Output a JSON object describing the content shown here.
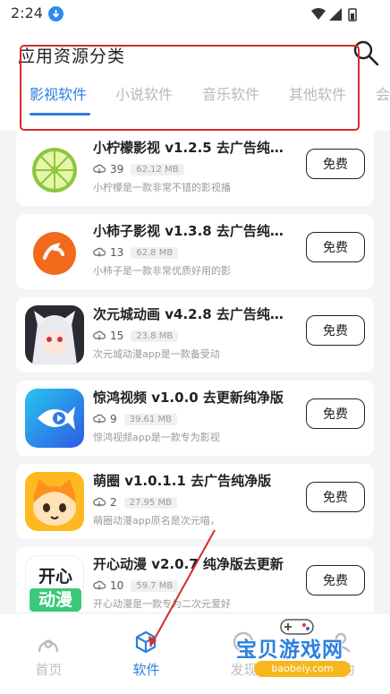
{
  "status_bar": {
    "time": "2:24"
  },
  "header": {
    "title": "应用资源分类",
    "tabs": [
      {
        "label": "影视软件"
      },
      {
        "label": "小说软件"
      },
      {
        "label": "音乐软件"
      },
      {
        "label": "其他软件"
      },
      {
        "label": "会"
      }
    ],
    "active_tab": 0
  },
  "apps": [
    {
      "name": "小柠檬影视 v1.2.5 去广告纯…",
      "downloads": "39",
      "size": "62.12 MB",
      "desc": "小柠檬是一款非常不错的影视播",
      "button": "免费",
      "icon": "lemon-icon"
    },
    {
      "name": "小柿子影视 v1.3.8 去广告纯…",
      "downloads": "13",
      "size": "62.8 MB",
      "desc": "小柿子是一款非常优质好用的影",
      "button": "免费",
      "icon": "persimmon-icon"
    },
    {
      "name": "次元城动画 v4.2.8 去广告纯…",
      "downloads": "15",
      "size": "23.8 MB",
      "desc": "次元城动漫app是一款备受动",
      "button": "免费",
      "icon": "anime-girl-icon"
    },
    {
      "name": "惊鸿视频 v1.0.0 去更新纯净版",
      "downloads": "9",
      "size": "39.61 MB",
      "desc": "惊鸿视频app是一款专为影视",
      "button": "免费",
      "icon": "fish-video-icon"
    },
    {
      "name": "萌圈 v1.0.1.1 去广告纯净版",
      "downloads": "2",
      "size": "27.95 MB",
      "desc": "萌圈动漫app原名是次元喵，",
      "button": "免费",
      "icon": "cat-face-icon"
    },
    {
      "name": "开心动漫 v2.0.7 纯净版去更新",
      "downloads": "10",
      "size": "59.7 MB",
      "desc": "开心动漫是一款专为二次元爱好",
      "button": "免费",
      "icon": "happy-anime-icon",
      "icon_text_top": "开心",
      "icon_text_bottom": "动漫"
    }
  ],
  "bottom_nav": [
    {
      "label": "首页",
      "icon": "home-icon"
    },
    {
      "label": "软件",
      "icon": "cube-icon"
    },
    {
      "label": "发现",
      "icon": "discover-icon"
    },
    {
      "label": "我的",
      "icon": "profile-icon"
    }
  ],
  "active_nav": 1,
  "watermark": {
    "title": "宝贝游戏网",
    "url": "baobeiy.com"
  },
  "colors": {
    "accent": "#2d7fe0",
    "highlight_box": "#d42b2b",
    "background": "#f4f4f6"
  }
}
